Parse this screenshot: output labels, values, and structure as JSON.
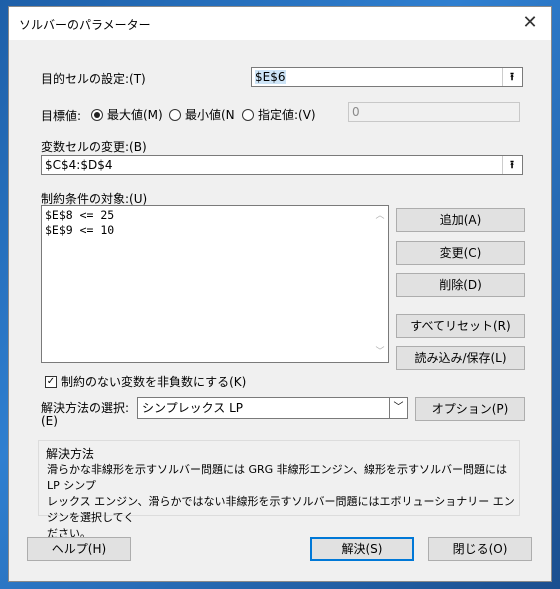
{
  "window": {
    "title": "ソルバーのパラメーター",
    "close_glyph": "✕"
  },
  "objective": {
    "label": "目的セルの設定:(T)",
    "value": "$E$6"
  },
  "target": {
    "label": "目標値:",
    "max": "最大値(M)",
    "min": "最小値(N",
    "value": "指定値:(V)",
    "value_field": "0",
    "selected": "max"
  },
  "variables": {
    "label": "変数セルの変更:(B)",
    "value": "$C$4:$D$4"
  },
  "constraints": {
    "label": "制約条件の対象:(U)",
    "items": [
      "$E$8 <= 25",
      "$E$9 <= 10"
    ]
  },
  "buttons": {
    "add": "追加(A)",
    "change": "変更(C)",
    "delete": "削除(D)",
    "reset": "すべてリセット(R)",
    "load_save": "読み込み/保存(L)",
    "options": "オプション(P)",
    "help": "ヘルプ(H)",
    "solve": "解決(S)",
    "close": "閉じる(O)"
  },
  "nonneg": {
    "label": "制約のない変数を非負数にする(K)",
    "checked": true
  },
  "method": {
    "label_line1": "解決方法の選択:",
    "label_line2": "(E)",
    "selected": "シンプレックス LP"
  },
  "description": {
    "heading": "解決方法",
    "line1": "滑らかな非線形を示すソルバー問題には GRG 非線形エンジン、線形を示すソルバー問題には LP シンプ",
    "line2": "レックス エンジン、滑らかではない非線形を示すソルバー問題にはエボリューショナリー エンジンを選択してく",
    "line3": "ださい。"
  }
}
